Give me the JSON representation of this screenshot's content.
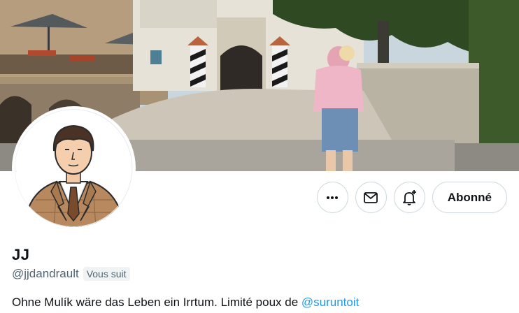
{
  "profile": {
    "display_name": "JJ",
    "handle": "@jjdandrault",
    "follows_you_badge": "Vous suit",
    "bio_text": "Ohne Mulík wäre das Leben ein Irrtum. Limité poux de ",
    "bio_mention": "@suruntoit"
  },
  "actions": {
    "more_icon": "more-horizontal-icon",
    "message_icon": "envelope-icon",
    "notify_icon": "bell-plus-icon",
    "follow_label": "Abonné"
  },
  "colors": {
    "link": "#1d9bf0",
    "secondary_text": "#536471",
    "border": "#cfd9de"
  }
}
